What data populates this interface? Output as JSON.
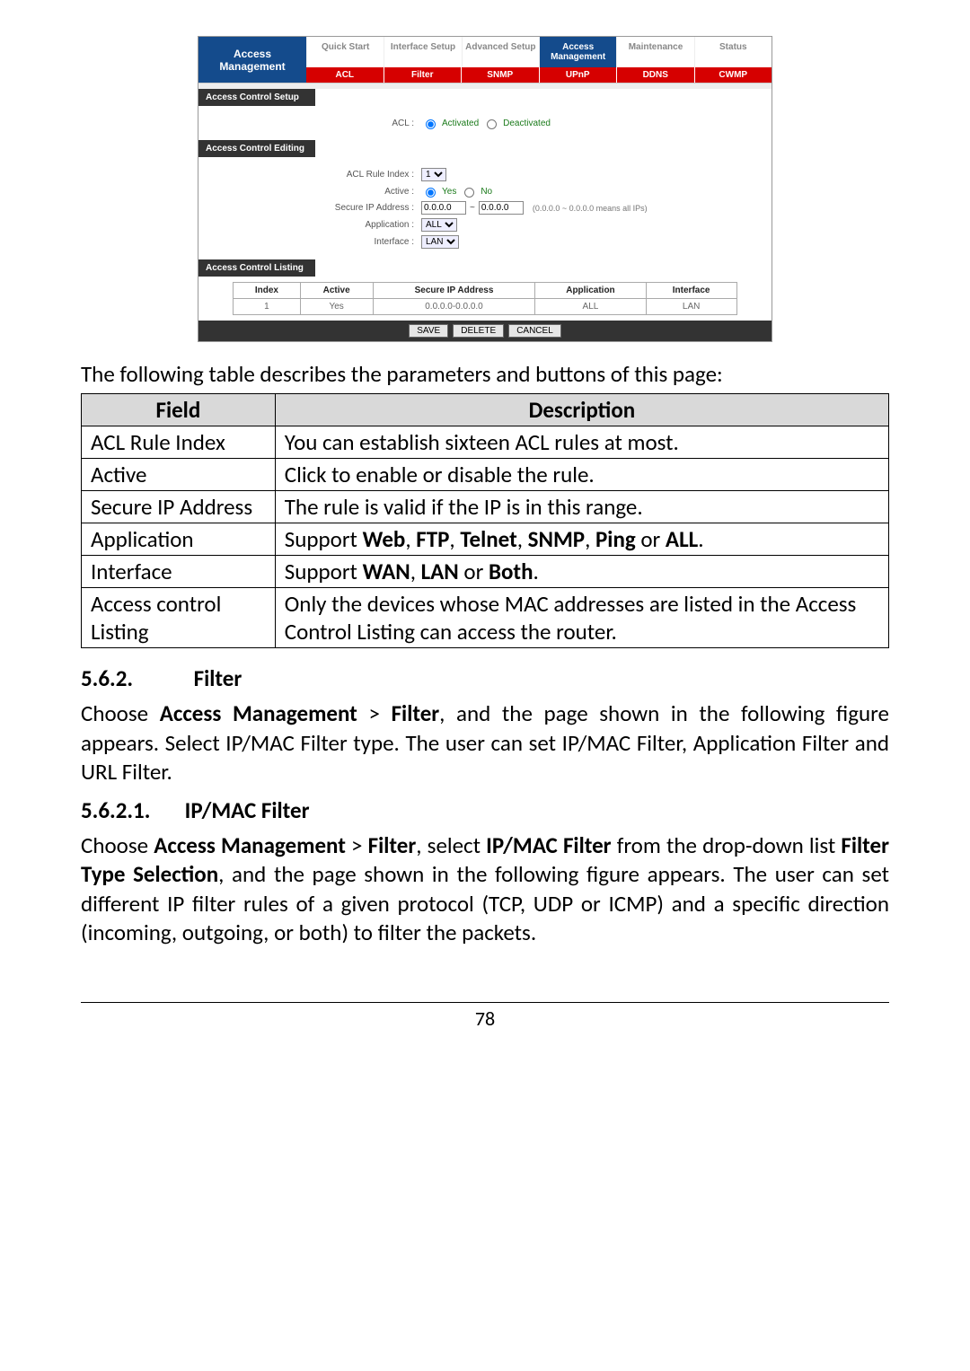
{
  "screenshot": {
    "sidebar": {
      "line1": "Access",
      "line2": "Management"
    },
    "main_tabs": [
      {
        "label": "Quick Start",
        "active": false
      },
      {
        "label": "Interface Setup",
        "active": false
      },
      {
        "label": "Advanced Setup",
        "active": false
      },
      {
        "label": "Access Management",
        "active": true
      },
      {
        "label": "Maintenance",
        "active": false
      },
      {
        "label": "Status",
        "active": false
      }
    ],
    "sub_tabs": [
      "ACL",
      "Filter",
      "SNMP",
      "UPnP",
      "DDNS",
      "CWMP"
    ],
    "sections": {
      "setup": "Access Control Setup",
      "editing": "Access Control Editing",
      "listing": "Access Control Listing"
    },
    "form": {
      "acl_label": "ACL :",
      "acl_opt1": "Activated",
      "acl_opt2": "Deactivated",
      "rule_index_label": "ACL Rule Index :",
      "rule_index_value": "1",
      "active_label": "Active :",
      "active_yes": "Yes",
      "active_no": "No",
      "secure_ip_label": "Secure IP Address :",
      "ip1": "0.0.0.0",
      "tilde": "~",
      "ip2": "0.0.0.0",
      "ip_hint": "(0.0.0.0 ~ 0.0.0.0 means all IPs)",
      "app_label": "Application :",
      "app_value": "ALL",
      "iface_label": "Interface :",
      "iface_value": "LAN"
    },
    "table": {
      "headers": [
        "Index",
        "Active",
        "Secure IP Address",
        "Application",
        "Interface"
      ],
      "row": [
        "1",
        "Yes",
        "0.0.0.0-0.0.0.0",
        "ALL",
        "LAN"
      ]
    },
    "buttons": {
      "save": "SAVE",
      "delete": "DELETE",
      "cancel": "CANCEL"
    }
  },
  "caption": "The following table describes the parameters and buttons of this page:",
  "desc_table": {
    "headers": [
      "Field",
      "Description"
    ],
    "rows": [
      [
        "ACL Rule Index",
        "You can establish sixteen ACL rules at most."
      ],
      [
        "Active",
        "Click to enable or disable the rule."
      ],
      [
        "Secure IP Address",
        "The rule is valid if the IP is in this range."
      ],
      [
        "Application",
        "Support <b>Web</b>, <b>FTP</b>, <b>Telnet</b>, <b>SNMP</b>, <b>Ping</b> or <b>ALL</b>."
      ],
      [
        "Interface",
        "Support <b>WAN</b>, <b>LAN</b> or <b>Both</b>."
      ],
      [
        "Access control Listing",
        "Only the devices whose MAC addresses are listed in the Access Control Listing can access the router."
      ]
    ]
  },
  "h3": {
    "num": "5.6.2.",
    "title": "Filter"
  },
  "para1": "Choose <b>Access Management</b> > <b>Filter</b>, and the page shown in the following figure appears. Select IP/MAC Filter type. The user can set IP/MAC Filter, Application Filter and URL Filter.",
  "h4": {
    "num": "5.6.2.1.",
    "title": "IP/MAC Filter"
  },
  "para2": "Choose <b>Access Management</b> > <b>Filter</b>, select <b>IP/MAC Filter</b> from the drop-down list <b>Filter Type Selection</b>, and the page shown in the following figure appears. The user can set different IP filter rules of a given protocol (TCP, UDP or ICMP) and a specific direction (incoming, outgoing, or both) to filter the packets.",
  "page_num": "78"
}
